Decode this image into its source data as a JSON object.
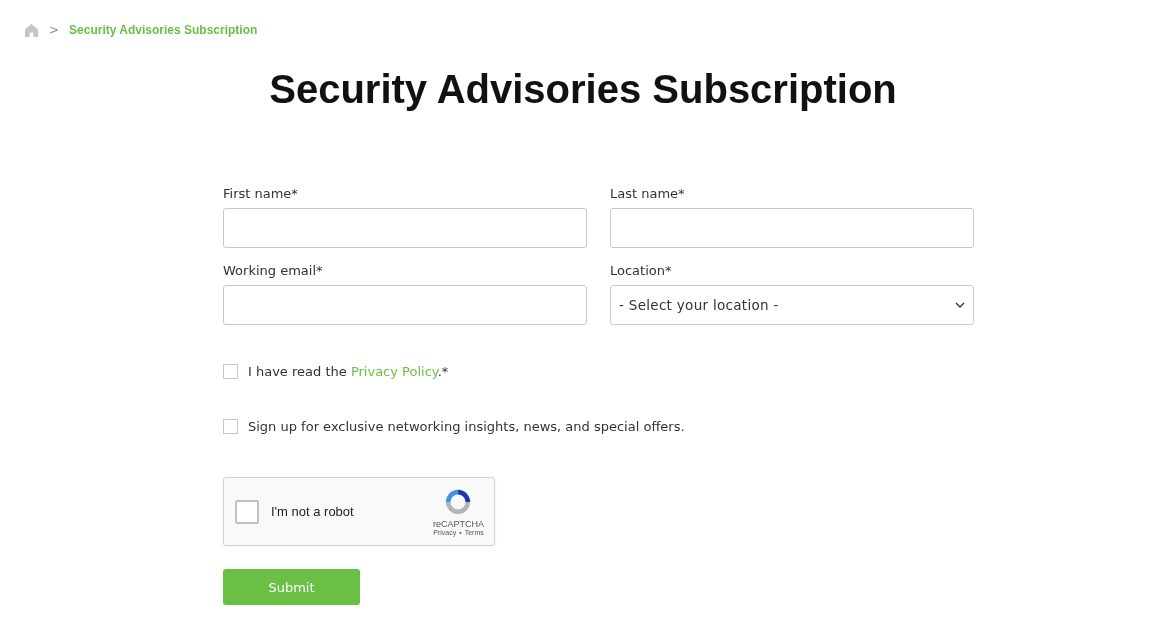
{
  "breadcrumb": {
    "separator": ">",
    "current": "Security Advisories Subscription"
  },
  "title": "Security Advisories Subscription",
  "fields": [
    {
      "label": "First name*",
      "kind": "text"
    },
    {
      "label": "Last name*",
      "kind": "text"
    },
    {
      "label": "Working email*",
      "kind": "text"
    },
    {
      "label": "Location*",
      "kind": "select",
      "value": "- Select your location -"
    }
  ],
  "checkboxes": [
    {
      "text_before": "I have read the ",
      "link": "Privacy Policy",
      "text_after": ".*",
      "checked": false
    },
    {
      "text_before": "Sign up for exclusive networking insights, news, and special offers.",
      "checked": false
    }
  ],
  "captcha": {
    "label": "I'm not a robot",
    "checked": false,
    "brand": "reCAPTCHA",
    "links": [
      "Privacy",
      "Terms"
    ],
    "separator": "•"
  },
  "submit": "Submit"
}
